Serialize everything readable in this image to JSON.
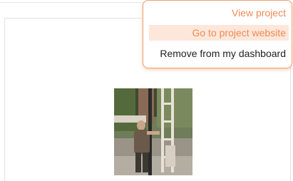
{
  "menu": {
    "items": [
      {
        "label": "View project"
      },
      {
        "label": "Go to project website"
      },
      {
        "label": "Remove from my dashboard"
      }
    ],
    "highlighted_index": 1,
    "accent_color": "#f08a55",
    "highlight_color": "#fde7da"
  },
  "card": {
    "thumbnail_icon": "project-photo"
  }
}
